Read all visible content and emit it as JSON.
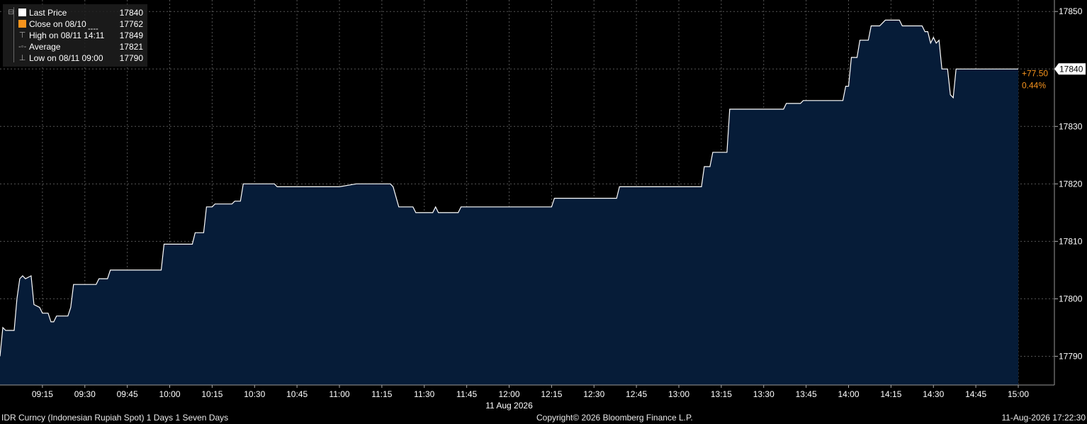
{
  "chart_data": {
    "type": "area",
    "colors": {
      "background": "#000000",
      "fill": "#061c38",
      "line": "#ffffff",
      "grid": "#555555",
      "close": "#f7941d",
      "change": "#f7941d"
    },
    "legend": {
      "placement": "top-left",
      "entries": [
        {
          "label": "Last Price",
          "value": "17840",
          "icon": "white-square"
        },
        {
          "label": "Close on 08/10",
          "value": "17762",
          "icon": "orange-square",
          "style": "----"
        },
        {
          "label": "High on 08/11 14:11",
          "value": "17849",
          "icon": "high-marker"
        },
        {
          "label": "Average",
          "value": "17821",
          "icon": "average-marker"
        },
        {
          "label": "Low on 08/11 09:00",
          "value": "17790",
          "icon": "low-marker"
        }
      ]
    },
    "ylim": [
      17785,
      17852
    ],
    "yticks": [
      "17790",
      "17800",
      "17810",
      "17820",
      "17830",
      "17840",
      "17850"
    ],
    "last_price_label": "17840",
    "change_label": "+77.50",
    "change_pct_label": "0.44%",
    "xlabel": "11 Aug 2026",
    "xlim_minutes": [
      540,
      900
    ],
    "xticks": [
      {
        "minute": 555,
        "label": "09:15"
      },
      {
        "minute": 570,
        "label": "09:30"
      },
      {
        "minute": 585,
        "label": "09:45"
      },
      {
        "minute": 600,
        "label": "10:00"
      },
      {
        "minute": 615,
        "label": "10:15"
      },
      {
        "minute": 630,
        "label": "10:30"
      },
      {
        "minute": 645,
        "label": "10:45"
      },
      {
        "minute": 660,
        "label": "11:00"
      },
      {
        "minute": 675,
        "label": "11:15"
      },
      {
        "minute": 690,
        "label": "11:30"
      },
      {
        "minute": 705,
        "label": "11:45"
      },
      {
        "minute": 720,
        "label": "12:00"
      },
      {
        "minute": 735,
        "label": "12:15"
      },
      {
        "minute": 750,
        "label": "12:30"
      },
      {
        "minute": 765,
        "label": "12:45"
      },
      {
        "minute": 780,
        "label": "13:00"
      },
      {
        "minute": 795,
        "label": "13:15"
      },
      {
        "minute": 810,
        "label": "13:30"
      },
      {
        "minute": 825,
        "label": "13:45"
      },
      {
        "minute": 840,
        "label": "14:00"
      },
      {
        "minute": 855,
        "label": "14:15"
      },
      {
        "minute": 870,
        "label": "14:30"
      },
      {
        "minute": 885,
        "label": "14:45"
      },
      {
        "minute": 900,
        "label": "15:00"
      }
    ],
    "grid": true,
    "series": [
      {
        "points": [
          [
            540,
            17790
          ],
          [
            541,
            17795
          ],
          [
            542,
            17794.5
          ],
          [
            545,
            17794.5
          ],
          [
            546,
            17800
          ],
          [
            547,
            17803.5
          ],
          [
            548,
            17804
          ],
          [
            549,
            17803.5
          ],
          [
            551,
            17804
          ],
          [
            552,
            17799
          ],
          [
            554,
            17798.5
          ],
          [
            555,
            17797.5
          ],
          [
            557,
            17797.5
          ],
          [
            558,
            17796
          ],
          [
            559,
            17796
          ],
          [
            560,
            17797
          ],
          [
            564,
            17797
          ],
          [
            565,
            17798.5
          ],
          [
            566,
            17802.5
          ],
          [
            574,
            17802.5
          ],
          [
            575,
            17803.5
          ],
          [
            578,
            17803.5
          ],
          [
            579,
            17805
          ],
          [
            597,
            17805
          ],
          [
            598,
            17809.5
          ],
          [
            608,
            17809.5
          ],
          [
            609,
            17811.5
          ],
          [
            612,
            17811.5
          ],
          [
            613,
            17816
          ],
          [
            615,
            17816
          ],
          [
            616,
            17816.5
          ],
          [
            622,
            17816.5
          ],
          [
            623,
            17817
          ],
          [
            625,
            17817
          ],
          [
            626,
            17820
          ],
          [
            637,
            17820
          ],
          [
            638,
            17819.5
          ],
          [
            660,
            17819.5
          ],
          [
            666,
            17820
          ],
          [
            678,
            17820
          ],
          [
            679,
            17819.5
          ],
          [
            681,
            17816
          ],
          [
            686,
            17816
          ],
          [
            687,
            17815
          ],
          [
            693,
            17815
          ],
          [
            694,
            17816
          ],
          [
            695,
            17815
          ],
          [
            702,
            17815
          ],
          [
            703,
            17816
          ],
          [
            735,
            17816
          ],
          [
            736,
            17817.5
          ],
          [
            758,
            17817.5
          ],
          [
            759,
            17819.5
          ],
          [
            788,
            17819.5
          ],
          [
            789,
            17823
          ],
          [
            791,
            17823
          ],
          [
            792,
            17825.5
          ],
          [
            797,
            17825.5
          ],
          [
            798,
            17833
          ],
          [
            817,
            17833
          ],
          [
            818,
            17834
          ],
          [
            823,
            17834
          ],
          [
            824,
            17834.5
          ],
          [
            838,
            17834.5
          ],
          [
            839,
            17837
          ],
          [
            840,
            17837
          ],
          [
            841,
            17842
          ],
          [
            843,
            17842
          ],
          [
            844,
            17845
          ],
          [
            847,
            17845
          ],
          [
            848,
            17847.5
          ],
          [
            851,
            17847.5
          ],
          [
            853,
            17848.5
          ],
          [
            858,
            17848.5
          ],
          [
            859,
            17847.5
          ],
          [
            866,
            17847.5
          ],
          [
            867,
            17846.5
          ],
          [
            868,
            17846.5
          ],
          [
            869,
            17844.5
          ],
          [
            870,
            17845.5
          ],
          [
            871,
            17844.5
          ],
          [
            872,
            17845
          ],
          [
            873,
            17840
          ],
          [
            875,
            17840
          ],
          [
            876,
            17835.5
          ],
          [
            877,
            17835
          ],
          [
            878,
            17840
          ],
          [
            900,
            17840
          ]
        ]
      }
    ]
  },
  "footer": {
    "left": "IDR Curncy (Indonesian Rupiah Spot) 1 Days 1 Seven Days",
    "center": "Copyright© 2026 Bloomberg Finance L.P.",
    "right": "11-Aug-2026 17:22:30"
  }
}
